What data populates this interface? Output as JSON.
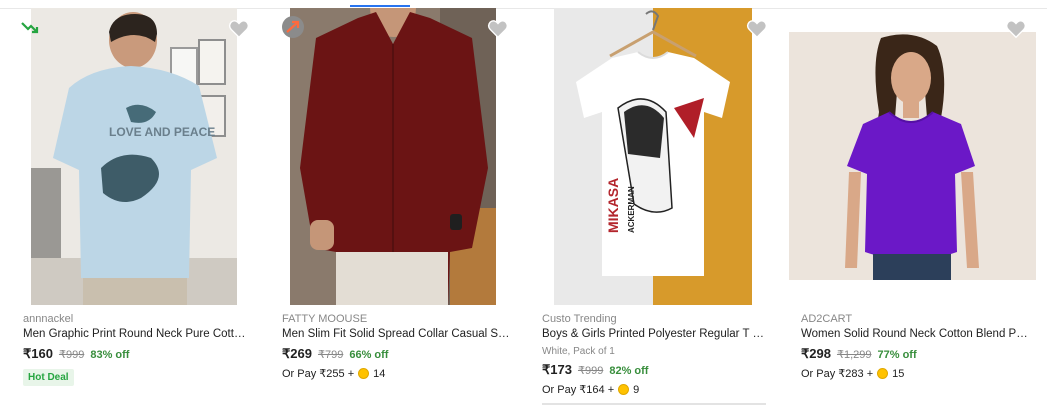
{
  "products": [
    {
      "brand": "annnackel",
      "title": "Men Graphic Print Round Neck Pure Cotton Li...",
      "price": "₹160",
      "mrp": "₹999",
      "discount": "83% off",
      "badge": "Hot Deal",
      "print": "LOVE AND PEACE"
    },
    {
      "brand": "FATTY MOOUSE",
      "title": "Men Slim Fit Solid Spread Collar Casual Shirt",
      "price": "₹269",
      "mrp": "₹799",
      "discount": "66% off",
      "or_pay": "Or Pay ₹255 +",
      "coins": "14"
    },
    {
      "brand": "Custo Trending",
      "title": "Boys & Girls Printed Polyester Regular T Shirt",
      "variant": "White, Pack of 1",
      "price": "₹173",
      "mrp": "₹999",
      "discount": "82% off",
      "or_pay": "Or Pay ₹164 +",
      "coins": "9",
      "print_main": "MIKASA",
      "print_sub": "ACKERMAN"
    },
    {
      "brand": "AD2CART",
      "title": "Women Solid Round Neck Cotton Blend Purpl...",
      "price": "₹298",
      "mrp": "₹1,299",
      "discount": "77% off",
      "or_pay": "Or Pay ₹283 +",
      "coins": "15"
    }
  ],
  "colors": {
    "accent": "#2874f0",
    "discount_green": "#388e3c",
    "coin": "#ffc200",
    "wishlist": "#c2c2c2"
  }
}
